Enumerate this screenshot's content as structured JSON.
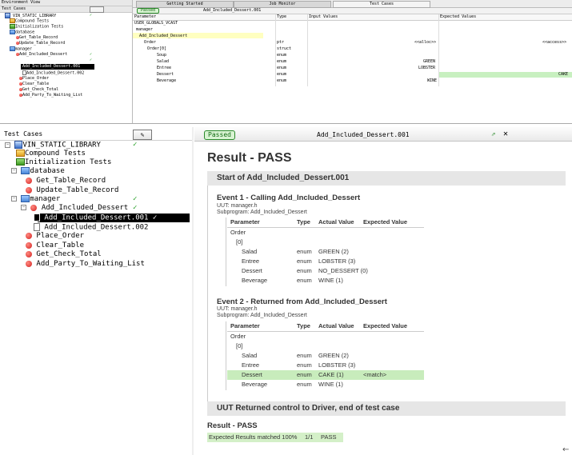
{
  "top": {
    "env_view_label": "Environment View",
    "test_cases_label": "Test Cases",
    "tabs": [
      "Getting Started",
      "Job Monitor",
      "Test Cases"
    ],
    "passed_label": "Passed",
    "tab_title": "Add_Included_Dessert.001",
    "tree": [
      "VIN_STATIC_LIBRARY",
      "Compound Tests",
      "Initialization Tests",
      "database",
      "Get_Table_Record",
      "Update_Table_Record",
      "manager",
      "Add_Included_Dessert",
      "Add_Included_Dessert.001",
      "Add_Included_Dessert.002",
      "Place_Order",
      "Clear_Table",
      "Get_Check_Total",
      "Add_Party_To_Waiting_List"
    ],
    "grid_headers": [
      "Parameter",
      "Type",
      "Input Values",
      "Expected Values"
    ],
    "grid_rows": [
      {
        "param": "USER_GLOBALS_VCAST",
        "type": "",
        "input": "",
        "expected": ""
      },
      {
        "param": "manager",
        "type": "",
        "input": "",
        "expected": ""
      },
      {
        "param": "Add_Included_Dessert",
        "type": "",
        "input": "",
        "expected": ""
      },
      {
        "param": "Order",
        "type": "ptr",
        "input": "<<alloc>>",
        "expected": "<<access>>"
      },
      {
        "param": "Order[0]",
        "type": "struct",
        "input": "",
        "expected": ""
      },
      {
        "param": "Soup",
        "type": "enum",
        "input": "",
        "expected": ""
      },
      {
        "param": "Salad",
        "type": "enum",
        "input": "GREEN",
        "expected": ""
      },
      {
        "param": "Entree",
        "type": "enum",
        "input": "LOBSTER",
        "expected": ""
      },
      {
        "param": "Dessert",
        "type": "enum",
        "input": "",
        "expected": "CAKE"
      },
      {
        "param": "Beverage",
        "type": "enum",
        "input": "WINE",
        "expected": ""
      }
    ]
  },
  "tree_panel": {
    "title": "Test Cases",
    "pin_icon": "pin-icon",
    "root": "VIN_STATIC_LIBRARY",
    "compound": "Compound Tests",
    "init": "Initialization Tests",
    "database": "database",
    "get_table": "Get_Table_Record",
    "update_table": "Update_Table_Record",
    "manager": "manager",
    "add_included": "Add_Included_Dessert",
    "add_included_001": "Add_Included_Dessert.001",
    "add_included_002": "Add_Included_Dessert.002",
    "place_order": "Place_Order",
    "clear_table": "Clear_Table",
    "get_check": "Get_Check_Total",
    "add_party": "Add_Party_To_Waiting_List"
  },
  "report": {
    "passed_tab": "Passed",
    "header_title": "Add_Included_Dessert.001",
    "result_title": "Result - PASS",
    "start_section": "Start of Add_Included_Dessert.001",
    "event1": {
      "title": "Event 1 - Calling Add_Included_Dessert",
      "uut": "UUT: manager.h",
      "subprogram": "Subprogram: Add_Included_Dessert",
      "headers": [
        "Parameter",
        "Type",
        "Actual Value",
        "Expected Value"
      ],
      "rows": [
        {
          "param": "Order",
          "type": "",
          "actual": "",
          "expected": ""
        },
        {
          "param": "[0]",
          "type": "",
          "actual": "",
          "expected": ""
        },
        {
          "param": "Salad",
          "type": "enum",
          "actual": "GREEN (2)",
          "expected": ""
        },
        {
          "param": "Entree",
          "type": "enum",
          "actual": "LOBSTER (3)",
          "expected": ""
        },
        {
          "param": "Dessert",
          "type": "enum",
          "actual": "NO_DESSERT (0)",
          "expected": ""
        },
        {
          "param": "Beverage",
          "type": "enum",
          "actual": "WINE (1)",
          "expected": ""
        }
      ]
    },
    "event2": {
      "title": "Event 2 - Returned from Add_Included_Dessert",
      "uut": "UUT: manager.h",
      "subprogram": "Subprogram: Add_Included_Dessert",
      "headers": [
        "Parameter",
        "Type",
        "Actual Value",
        "Expected Value"
      ],
      "rows": [
        {
          "param": "Order",
          "type": "",
          "actual": "",
          "expected": ""
        },
        {
          "param": "[0]",
          "type": "",
          "actual": "",
          "expected": ""
        },
        {
          "param": "Salad",
          "type": "enum",
          "actual": "GREEN (2)",
          "expected": ""
        },
        {
          "param": "Entree",
          "type": "enum",
          "actual": "LOBSTER (3)",
          "expected": ""
        },
        {
          "param": "Dessert",
          "type": "enum",
          "actual": "CAKE (1)",
          "expected": "<match>"
        },
        {
          "param": "Beverage",
          "type": "enum",
          "actual": "WINE (1)",
          "expected": ""
        }
      ]
    },
    "end_section": "UUT Returned control to Driver, end of test case",
    "summary_title": "Result - PASS",
    "summary": {
      "label": "Expected Results matched 100%",
      "ratio": "1/1",
      "status": "PASS"
    }
  },
  "colors": {
    "pass_green": "#d4f0c8",
    "match_green": "#c8ecbc",
    "selected": "#000000",
    "check": "#2aa12a"
  }
}
